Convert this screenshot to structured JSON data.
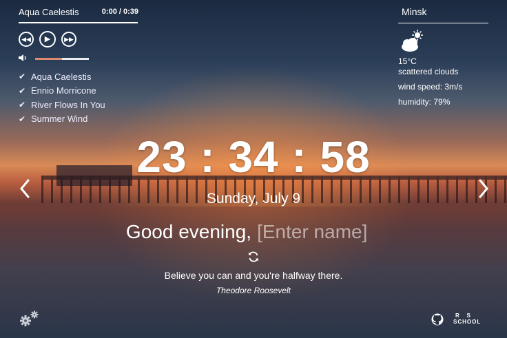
{
  "player": {
    "current_track": "Aqua Caelestis",
    "time": "0:00 / 0:39",
    "progress": 0,
    "volume": 0.5,
    "playlist": [
      {
        "title": "Aqua Caelestis"
      },
      {
        "title": "Ennio Morricone"
      },
      {
        "title": "River Flows In You"
      },
      {
        "title": "Summer Wind"
      }
    ]
  },
  "weather": {
    "city": "Minsk",
    "icon": "partly-cloudy-icon",
    "temperature": "15°C",
    "description": "scattered clouds",
    "wind": "wind speed: 3m/s",
    "humidity": "humidity: 79%"
  },
  "clock": {
    "time": "23 : 34 : 58",
    "date": "Sunday, July 9"
  },
  "greeting": {
    "text": "Good evening,",
    "name_placeholder": "[Enter name]",
    "name_value": ""
  },
  "quote": {
    "text": "Believe you can and you're halfway there.",
    "author": "Theodore Roosevelt"
  },
  "footer": {
    "logo_text_top": "R   S",
    "logo_text_bottom": "SCHOOL"
  },
  "colors": {
    "volume_fill": "#e08a6e",
    "text": "#ffffff"
  }
}
